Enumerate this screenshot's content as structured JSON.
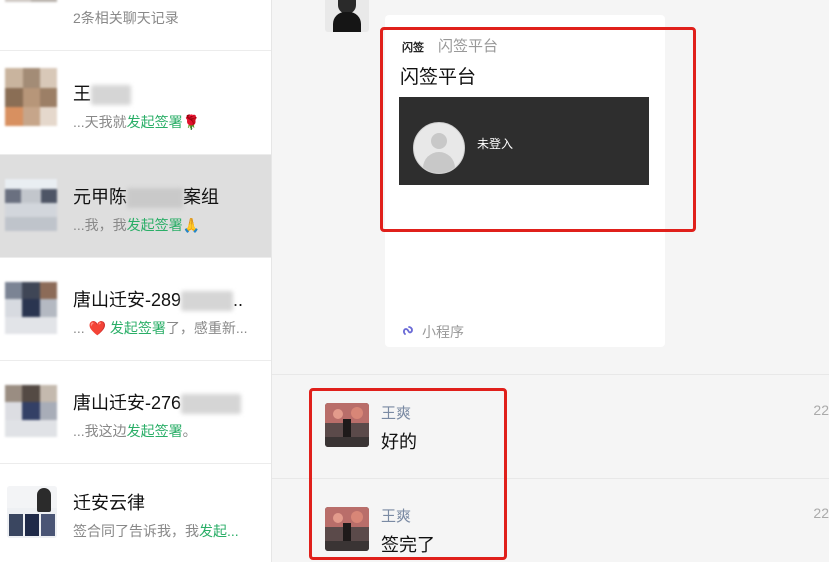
{
  "sidebar": {
    "items": [
      {
        "name": "",
        "preview": [
          {
            "text": "2条相关聊天记录",
            "green": false
          }
        ]
      },
      {
        "name": "王",
        "preview": [
          {
            "text": "...天我就",
            "green": false
          },
          {
            "text": "发起签署",
            "green": true
          },
          {
            "text": "🌹",
            "green": false
          }
        ]
      },
      {
        "name": "元甲陈",
        "name_suffix": "案组",
        "preview": [
          {
            "text": "...我，我",
            "green": false
          },
          {
            "text": "发起签署",
            "green": true
          },
          {
            "text": "🙏",
            "green": false
          }
        ]
      },
      {
        "name": "唐山迁安-289",
        "name_suffix": "..",
        "preview": [
          {
            "text": "... ",
            "green": false
          },
          {
            "text": "❤️",
            "green": false
          },
          {
            "text": " 发起签署",
            "green": true
          },
          {
            "text": "了，感重新...",
            "green": false
          }
        ]
      },
      {
        "name": "唐山迁安-276",
        "preview": [
          {
            "text": "...我这边",
            "green": false
          },
          {
            "text": "发起签署",
            "green": true
          },
          {
            "text": "。",
            "green": false
          }
        ]
      },
      {
        "name": "迁安云律",
        "preview": [
          {
            "text": "签合同了告诉我，我",
            "green": false
          },
          {
            "text": "发起...",
            "green": true
          }
        ]
      }
    ]
  },
  "chat": {
    "card": {
      "source_logo": "闪签",
      "source_name": "闪签平台",
      "title": "闪签平台",
      "login_text": "未登入",
      "mini_program_label": "小程序",
      "mini_program_icon": "mini-program-icon"
    },
    "messages": [
      {
        "sender": "王爽",
        "text": "好的",
        "time": "22"
      },
      {
        "sender": "王爽",
        "text": "签完了",
        "time": "22"
      }
    ]
  },
  "colors": {
    "keyword_green": "#2aae67",
    "highlight_red": "#e0201b",
    "sidebar_active": "#dedede"
  }
}
